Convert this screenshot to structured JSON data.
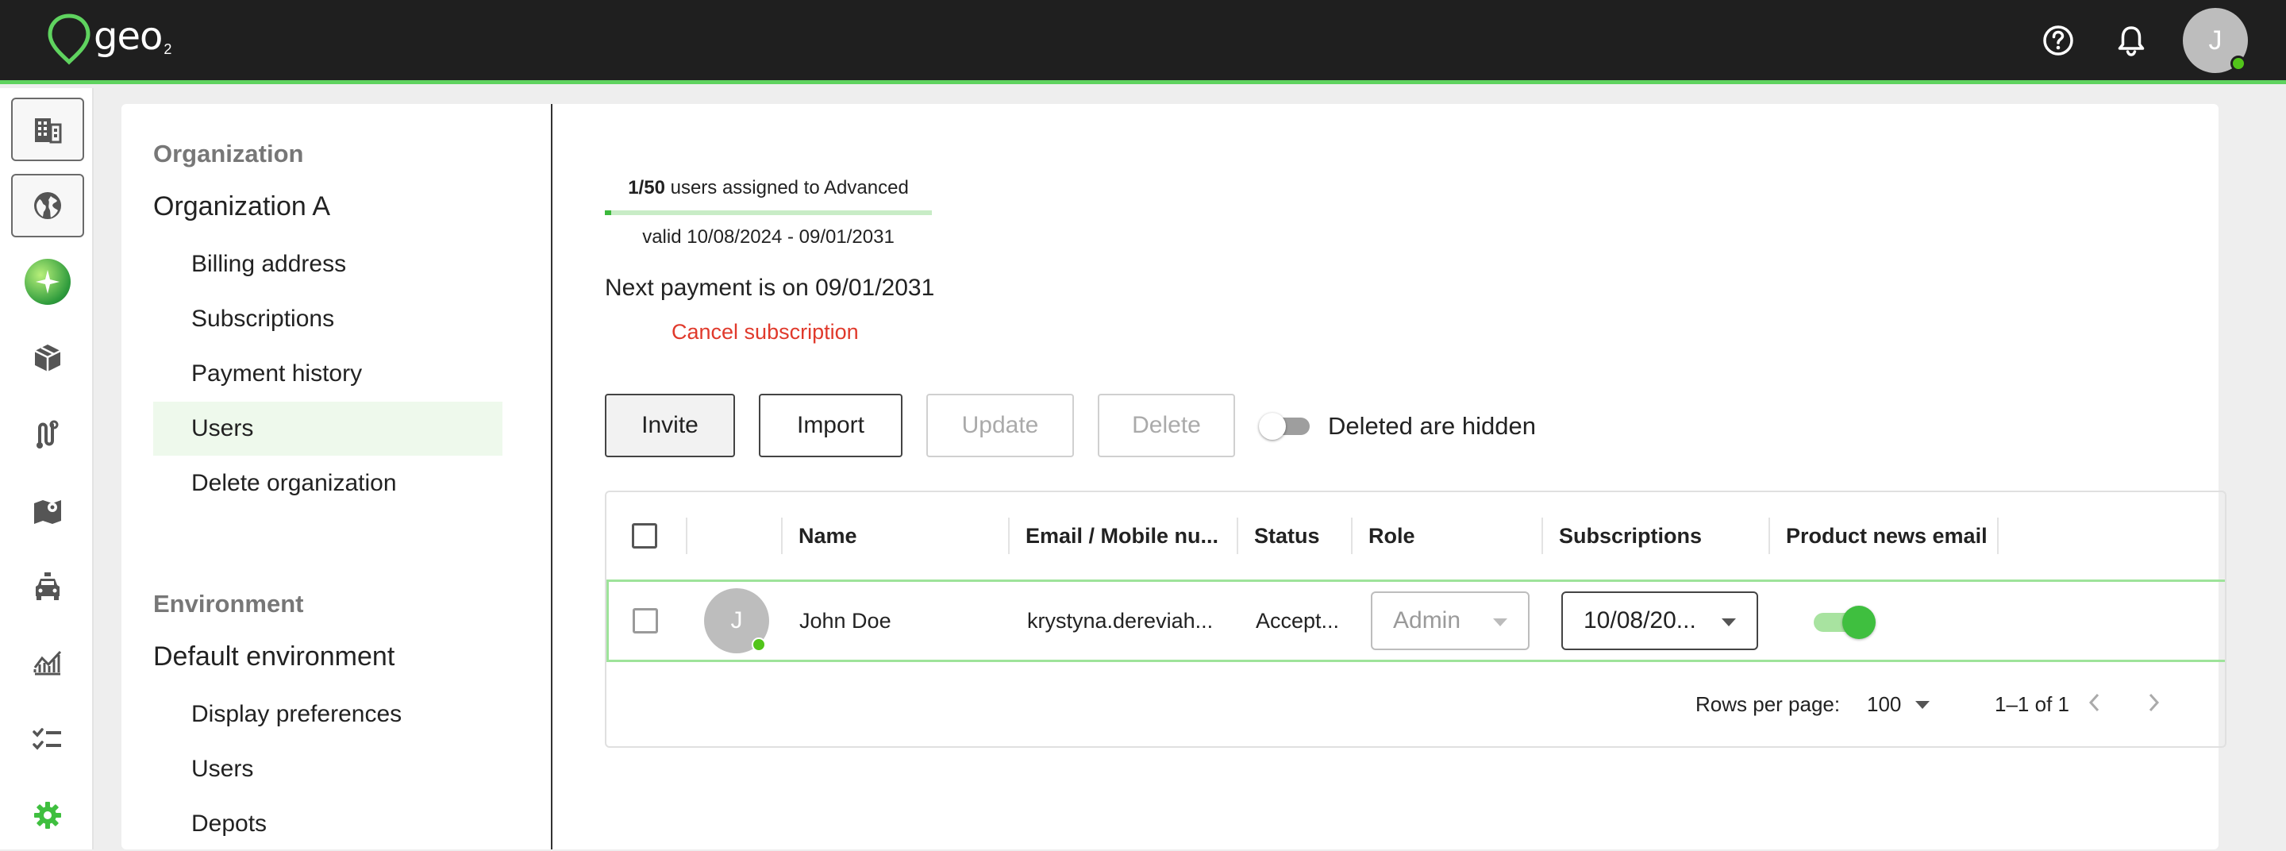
{
  "app": {
    "logo_text": "geo",
    "logo_sub": "2"
  },
  "topbar": {
    "help_icon": "help-circle-icon",
    "bell_icon": "bell-icon",
    "avatar_initial": "J"
  },
  "rail": {
    "items": [
      {
        "name": "organization",
        "icon": "building-icon"
      },
      {
        "name": "environment",
        "icon": "globe-icon"
      },
      {
        "name": "ai-assistant",
        "icon": "sparkle-icon"
      },
      {
        "name": "packages",
        "icon": "package-icon"
      },
      {
        "name": "routes",
        "icon": "route-icon"
      },
      {
        "name": "map",
        "icon": "map-icon"
      },
      {
        "name": "vehicles",
        "icon": "car-icon"
      },
      {
        "name": "analytics",
        "icon": "chart-icon"
      },
      {
        "name": "tasks",
        "icon": "checklist-icon"
      },
      {
        "name": "settings",
        "icon": "gear-icon"
      }
    ]
  },
  "nav": {
    "org_heading": "Organization",
    "org_name": "Organization A",
    "org_items": [
      "Billing address",
      "Subscriptions",
      "Payment history",
      "Users",
      "Delete organization"
    ],
    "active_item": "Users",
    "env_heading": "Environment",
    "env_name": "Default environment",
    "env_items": [
      "Display preferences",
      "Users",
      "Depots"
    ]
  },
  "subscription": {
    "assigned_count": "1/50",
    "assigned_text": " users assigned to Advanced",
    "assigned_fraction": 0.02,
    "valid": "valid 10/08/2024 - 09/01/2031",
    "next_payment": "Next payment is on 09/01/2031",
    "cancel_label": "Cancel subscription"
  },
  "toolbar": {
    "invite": "Invite",
    "import": "Import",
    "update": "Update",
    "delete": "Delete",
    "deleted_toggle_label": "Deleted are hidden",
    "deleted_toggle_on": false,
    "refresh_icon": "refresh-icon"
  },
  "table": {
    "columns": [
      "",
      "",
      "Name",
      "Email / Mobile nu...",
      "Status",
      "Role",
      "Subscriptions",
      "Product news email"
    ],
    "rows": [
      {
        "avatar_initial": "J",
        "name": "John Doe",
        "email": "krystyna.dereviah...",
        "status": "Accept...",
        "role": "Admin",
        "subscription": "10/08/20...",
        "product_news": true
      }
    ],
    "footer": {
      "rows_per_page_label": "Rows per page:",
      "rows_per_page_value": "100",
      "range": "1–1 of 1"
    }
  },
  "colors": {
    "accent": "#5fd35f",
    "danger": "#e0392b",
    "topbar": "#1f1f1f"
  }
}
